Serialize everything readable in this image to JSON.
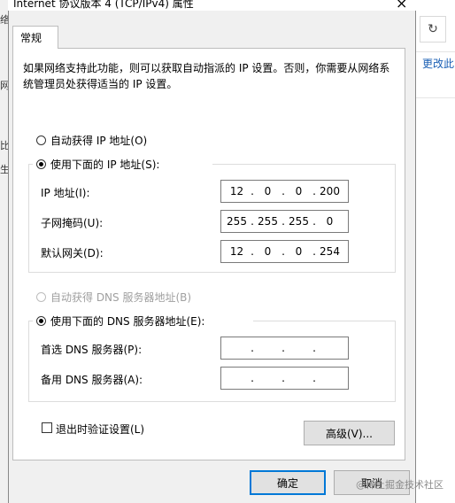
{
  "dialog": {
    "title": "Internet 协议版本 4 (TCP/IPv4) 属性",
    "close_glyph": "×"
  },
  "background": {
    "refresh_glyph": "↻",
    "more_link": "更改此",
    "left_chars": [
      "络",
      "网",
      "比",
      "生"
    ]
  },
  "tabs": [
    {
      "label": "常规"
    }
  ],
  "description": "如果网络支持此功能，则可以获取自动指派的 IP 设置。否则，你需要从网络系统管理员处获得适当的 IP 设置。",
  "ip": {
    "auto_label": "自动获得 IP 地址(O)",
    "manual_label": "使用下面的 IP 地址(S):",
    "address_label": "IP 地址(I):",
    "address": [
      "12",
      "0",
      "0",
      "200"
    ],
    "mask_label": "子网掩码(U):",
    "mask": [
      "255",
      "255",
      "255",
      "0"
    ],
    "gateway_label": "默认网关(D):",
    "gateway": [
      "12",
      "0",
      "0",
      "254"
    ]
  },
  "dns": {
    "auto_label": "自动获得 DNS 服务器地址(B)",
    "manual_label": "使用下面的 DNS 服务器地址(E):",
    "preferred_label": "首选 DNS 服务器(P):",
    "preferred": [
      "",
      "",
      "",
      ""
    ],
    "alternate_label": "备用 DNS 服务器(A):",
    "alternate": [
      "",
      "",
      "",
      ""
    ]
  },
  "validate_label": "退出时验证设置(L)",
  "advanced_label": "高级(V)...",
  "ok_label": "确定",
  "cancel_label": "取消",
  "watermark": "@稀土掘金技术社区",
  "state": {
    "ip_mode": "manual",
    "dns_mode": "manual",
    "dns_auto_enabled": false,
    "validate_on_exit": false
  }
}
